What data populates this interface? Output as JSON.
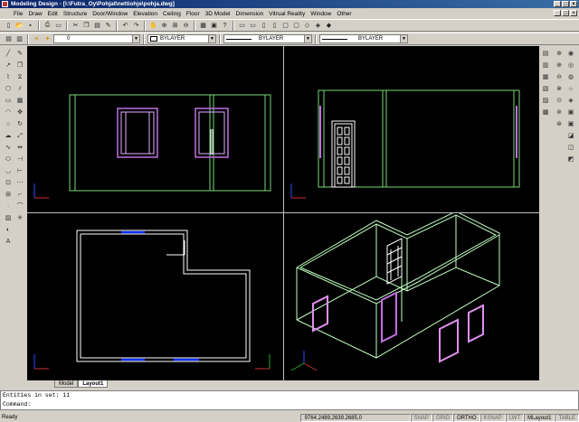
{
  "window": {
    "title": "Modeling Design - [I:\\Futra_Oy\\Pohjat\\nettiohje\\pohja.dwg]"
  },
  "menu": [
    "File",
    "Draw",
    "Edit",
    "Structure",
    "Door/Window",
    "Elevation",
    "Ceiling",
    "Floor",
    "3D Model",
    "Dimension",
    "Vitrual Reality",
    "Window",
    "Other"
  ],
  "properties_bar": {
    "layer": "0",
    "color": "BYLAYER",
    "linetype": "BYLAYER",
    "lineweight": "BYLAYER"
  },
  "tabs": [
    "Model",
    "Layout1"
  ],
  "command": {
    "line1": "Entities in set: 11",
    "line2": "Command:"
  },
  "status": {
    "ready": "Ready",
    "coords": "9764.2489,2639.2685,0",
    "toggles": [
      "SNAP",
      "GRID",
      "ORTHO",
      "KSNAP",
      "LWT",
      "MLayout1",
      "TABLE"
    ]
  },
  "icons": {
    "toolbar1": [
      "new",
      "open",
      "save",
      "print",
      "preview",
      "cut",
      "copy",
      "paste",
      "match",
      "undo",
      "redo",
      "pan",
      "zoom",
      "zoom-window",
      "zoom-prev",
      "properties",
      "design-center",
      "help"
    ],
    "toolbar2": [
      "view-top",
      "view-bottom",
      "view-left",
      "view-right",
      "view-front",
      "view-back",
      "view-iso-sw",
      "view-iso-se"
    ]
  },
  "colors": {
    "cad_bg": "#000000",
    "wall": "#78d878",
    "window": "#c070e0",
    "door": "#ffffff",
    "door_wall_line": "#3060ff"
  }
}
